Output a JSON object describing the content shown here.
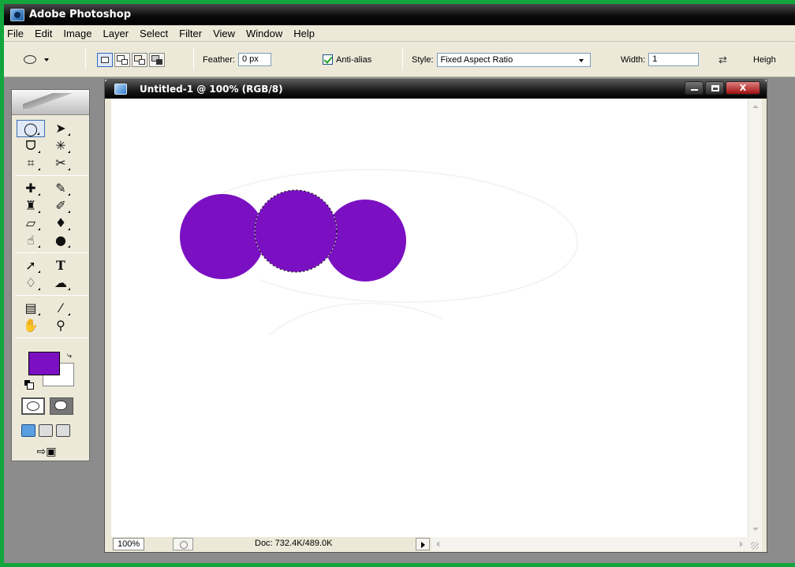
{
  "app": {
    "title": "Adobe Photoshop",
    "icon": "photoshop-icon"
  },
  "menu": [
    "File",
    "Edit",
    "Image",
    "Layer",
    "Select",
    "Filter",
    "View",
    "Window",
    "Help"
  ],
  "options": {
    "feather_label": "Feather:",
    "feather_value": "0 px",
    "antialias_label": "Anti-alias",
    "antialias_checked": true,
    "style_label": "Style:",
    "style_value": "Fixed Aspect Ratio",
    "width_label": "Width:",
    "width_value": "1",
    "height_label": "Heigh"
  },
  "toolbox": {
    "tools": [
      [
        "elliptical-marquee-tool",
        "move-tool"
      ],
      [
        "lasso-tool",
        "magic-wand-tool"
      ],
      [
        "crop-tool",
        "slice-tool"
      ],
      [
        "healing-brush-tool",
        "brush-tool"
      ],
      [
        "clone-stamp-tool",
        "history-brush-tool"
      ],
      [
        "eraser-tool",
        "paint-bucket-tool"
      ],
      [
        "smudge-tool",
        "burn-tool"
      ],
      [
        "path-selection-tool",
        "type-tool"
      ],
      [
        "pen-tool",
        "custom-shape-tool"
      ],
      [
        "notes-tool",
        "eyedropper-tool"
      ],
      [
        "hand-tool",
        "zoom-tool"
      ]
    ],
    "type_glyph": "T",
    "foreground_color": "#7b10c2",
    "background_color": "#ffffff"
  },
  "document": {
    "title": "Untitled-1 @ 100% (RGB/8)",
    "zoom": "100%",
    "doc_size": "Doc: 732.4K/489.0K",
    "circle_color": "#7b10c2"
  },
  "window_buttons": {
    "minimize": "minimize-icon",
    "maximize": "maximize-icon",
    "close": "X"
  }
}
